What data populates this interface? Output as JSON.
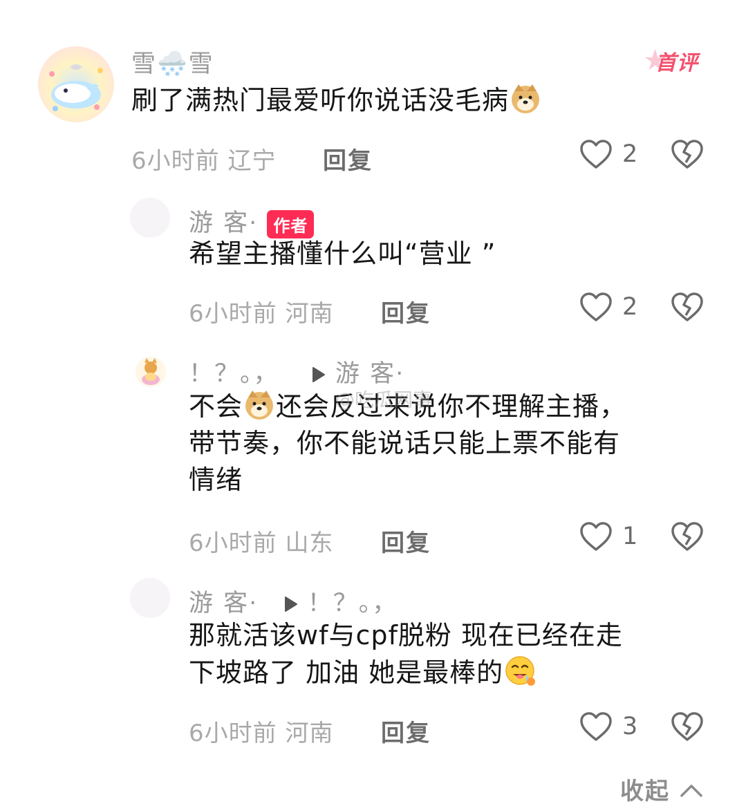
{
  "comments": [
    {
      "username": "雪🌨️雪",
      "first_badge": "首评",
      "text": "刷了满热门最爱听你说话没毛病",
      "time": "6小时前",
      "location": "辽宁",
      "reply_label": "回复",
      "likes": "2"
    },
    {
      "username": "游 客·",
      "author_badge": "作者",
      "text": "希望主播懂什么叫“营业 ”",
      "time": "6小时前",
      "location": "河南",
      "reply_label": "回复",
      "likes": "2"
    },
    {
      "username": "！？。，",
      "reply_to": "游 客·",
      "text_a": "不会",
      "text_b": "还会反过来说你不理解主播，",
      "text_c": "带节奏，你不能说话只能上票不能有",
      "text_d": "情绪",
      "time": "6小时前",
      "location": "山东",
      "reply_label": "回复",
      "likes": "1"
    },
    {
      "username": "游 客·",
      "reply_to": "！？。，",
      "text_a": "那就活该wf与cpf脱粉 现在已经在走",
      "text_b": "下坡路了 加油 她是最棒的",
      "time": "6小时前",
      "location": "河南",
      "reply_label": "回复",
      "likes": "3"
    }
  ],
  "collapse_label": "收起",
  "watermark": "@吃瓜网事",
  "colors": {
    "accent": "#fe2c55",
    "first_badge": "#f4516f",
    "meta": "#a9a9a9"
  },
  "icons": [
    "heart-icon",
    "dislike-icon",
    "play-arrow-icon",
    "chevron-up-icon",
    "doge-emoji",
    "drooling-emoji"
  ]
}
